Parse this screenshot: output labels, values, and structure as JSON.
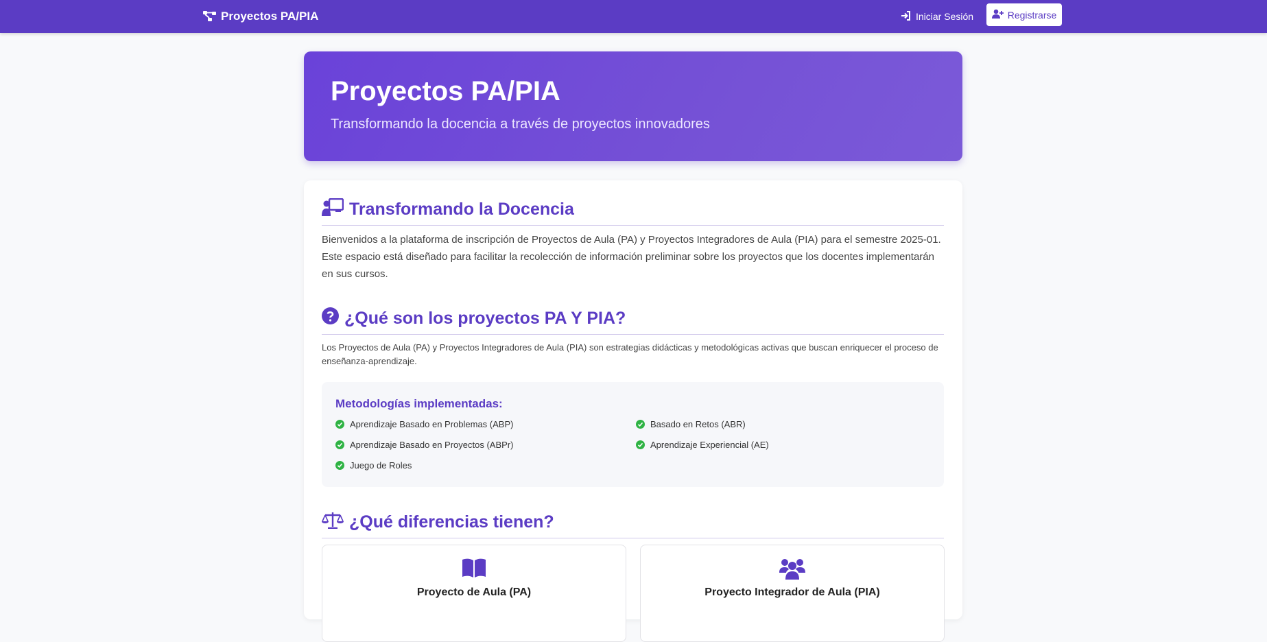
{
  "navbar": {
    "brand": "Proyectos PA/PIA",
    "login_label": "Iniciar Sesión",
    "register_label": "Registrarse"
  },
  "hero": {
    "title": "Proyectos PA/PIA",
    "subtitle": "Transformando la docencia a través de proyectos innovadores"
  },
  "section1": {
    "title": "Transformando la Docencia",
    "text": "Bienvenidos a la plataforma de inscripción de Proyectos de Aula (PA) y Proyectos Integradores de Aula (PIA) para el semestre 2025-01. Este espacio está diseñado para facilitar la recolección de información preliminar sobre los proyectos que los docentes implementarán en sus cursos."
  },
  "section2": {
    "title": "¿Qué son los proyectos PA Y PIA?",
    "text": "Los Proyectos de Aula (PA) y Proyectos Integradores de Aula (PIA) son estrategias didácticas y metodológicas activas que buscan enriquecer el proceso de enseñanza-aprendizaje.",
    "methods_title": "Metodologías implementadas:",
    "methods": [
      "Aprendizaje Basado en Problemas (ABP)",
      "Basado en Retos (ABR)",
      "Aprendizaje Basado en Proyectos (ABPr)",
      "Aprendizaje Experiencial (AE)",
      "Juego de Roles"
    ]
  },
  "section3": {
    "title": "¿Qué diferencias tienen?",
    "pa_title": "Proyecto de Aula (PA)",
    "pia_title": "Proyecto Integrador de Aula (PIA)"
  },
  "colors": {
    "primary": "#5b3cc4",
    "check": "#2fb344"
  },
  "icons": {
    "brand": "project-diagram-icon",
    "login": "sign-in-icon",
    "register": "user-plus-icon",
    "section1": "chalkboard-teacher-icon",
    "section2": "question-circle-icon",
    "section3": "balance-scale-icon",
    "pa": "book-open-icon",
    "pia": "users-icon"
  }
}
